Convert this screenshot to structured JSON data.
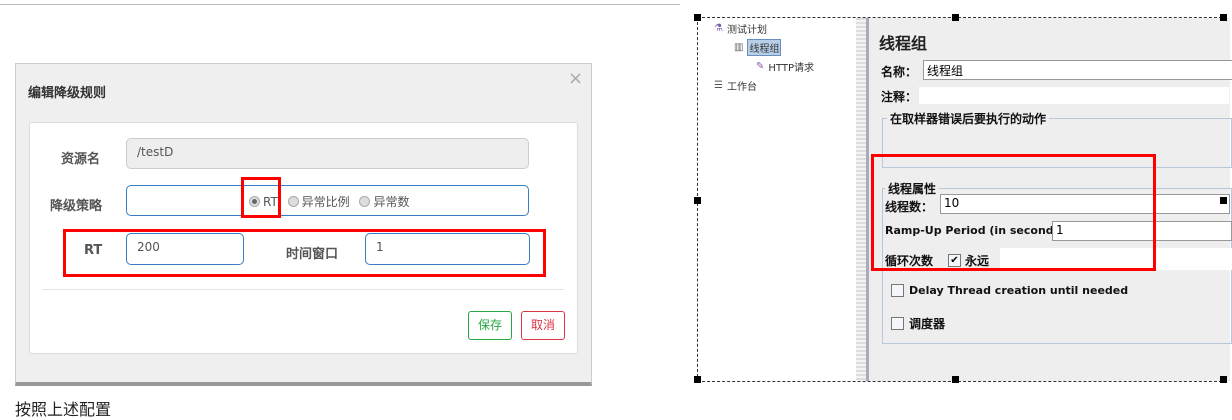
{
  "dialog": {
    "title": "编辑降级规则",
    "close": "×",
    "resource_label": "资源名",
    "resource_value": "/testD",
    "strategy_label": "降级策略",
    "strategy_options": [
      "RT",
      "异常比例",
      "异常数"
    ],
    "strategy_selected": "RT",
    "rt_label": "RT",
    "rt_value": "200",
    "window_label": "时间窗口",
    "window_value": "1",
    "save": "保存",
    "cancel": "取消"
  },
  "caption": "按照上述配置",
  "jmeter": {
    "tree": [
      "测试计划",
      "线程组",
      "HTTP请求",
      "工作台"
    ],
    "title": "线程组",
    "name_label": "名称：",
    "name_value": "线程组",
    "comment_label": "注释：",
    "error_group": "在取样器错误后要执行的动作",
    "thread_group": "线程属性",
    "threads_label": "线程数：",
    "threads_value": "10",
    "rampup_label": "Ramp-Up Period (in seconds):",
    "rampup_value": "1",
    "loop_label": "循环次数",
    "forever_label": "永远",
    "forever_checked": true,
    "delay_label": "Delay Thread creation until needed",
    "scheduler_label": "调度器"
  },
  "colors": {
    "highlight": "#ff0000",
    "save": "#28a745",
    "cancel": "#dc3545",
    "input_border": "#3b7dc4"
  }
}
